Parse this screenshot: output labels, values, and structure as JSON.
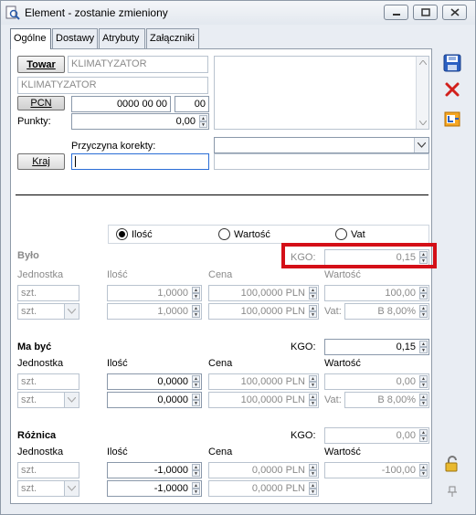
{
  "window": {
    "title": "Element - zostanie zmieniony"
  },
  "tabs": [
    "Ogólne",
    "Dostawy",
    "Atrybuty",
    "Załączniki"
  ],
  "header": {
    "towar_button": "Towar",
    "towar_code": "KLIMATYZATOR",
    "towar_name": "KLIMATYZATOR",
    "pcn_button": "PCN",
    "pcn_value": "0000 00 00",
    "pcn_suffix": "00",
    "punkty_label": "Punkty:",
    "punkty_value": "0,00",
    "przyczyna_label": "Przyczyna korekty:",
    "przyczyna_value": "",
    "kraj_button": "Kraj",
    "kraj_value": "",
    "kraj_name": ""
  },
  "radio": {
    "options": [
      "Ilość",
      "Wartość",
      "Vat"
    ],
    "selected": "Ilość"
  },
  "bylo": {
    "title": "Było",
    "kgo_label": "KGO:",
    "kgo_value": "0,15",
    "col_jednostka": "Jednostka",
    "col_ilosc": "Ilość",
    "col_cena": "Cena",
    "col_wartosc": "Wartość",
    "row1": {
      "jednostka": "szt.",
      "ilosc": "1,0000",
      "cena": "100,0000 PLN",
      "wartosc": "100,00"
    },
    "row2": {
      "jednostka": "szt.",
      "ilosc": "1,0000",
      "cena": "100,0000 PLN",
      "vat_label": "Vat:",
      "vat": "B 8,00%"
    }
  },
  "ma_byc": {
    "title": "Ma być",
    "kgo_label": "KGO:",
    "kgo_value": "0,15",
    "col_jednostka": "Jednostka",
    "col_ilosc": "Ilość",
    "col_cena": "Cena",
    "col_wartosc": "Wartość",
    "row1": {
      "jednostka": "szt.",
      "ilosc": "0,0000",
      "cena": "100,0000 PLN",
      "wartosc": "0,00"
    },
    "row2": {
      "jednostka": "szt.",
      "ilosc": "0,0000",
      "cena": "100,0000 PLN",
      "vat_label": "Vat:",
      "vat": "B 8,00%"
    }
  },
  "roznica": {
    "title": "Różnica",
    "kgo_label": "KGO:",
    "kgo_value": "0,00",
    "col_jednostka": "Jednostka",
    "col_ilosc": "Ilość",
    "col_cena": "Cena",
    "col_wartosc": "Wartość",
    "row1": {
      "jednostka": "szt.",
      "ilosc": "-1,0000",
      "cena": "0,0000 PLN",
      "wartosc": "-100,00"
    },
    "row2": {
      "jednostka": "szt.",
      "ilosc": "-1,0000",
      "cena": "0,0000 PLN"
    }
  },
  "side_icons": [
    "save-icon",
    "cancel-icon",
    "history-icon",
    "lock-icon",
    "pin-icon"
  ],
  "colors": {
    "highlight": "#d40f17",
    "accent": "#2a6dd6"
  }
}
